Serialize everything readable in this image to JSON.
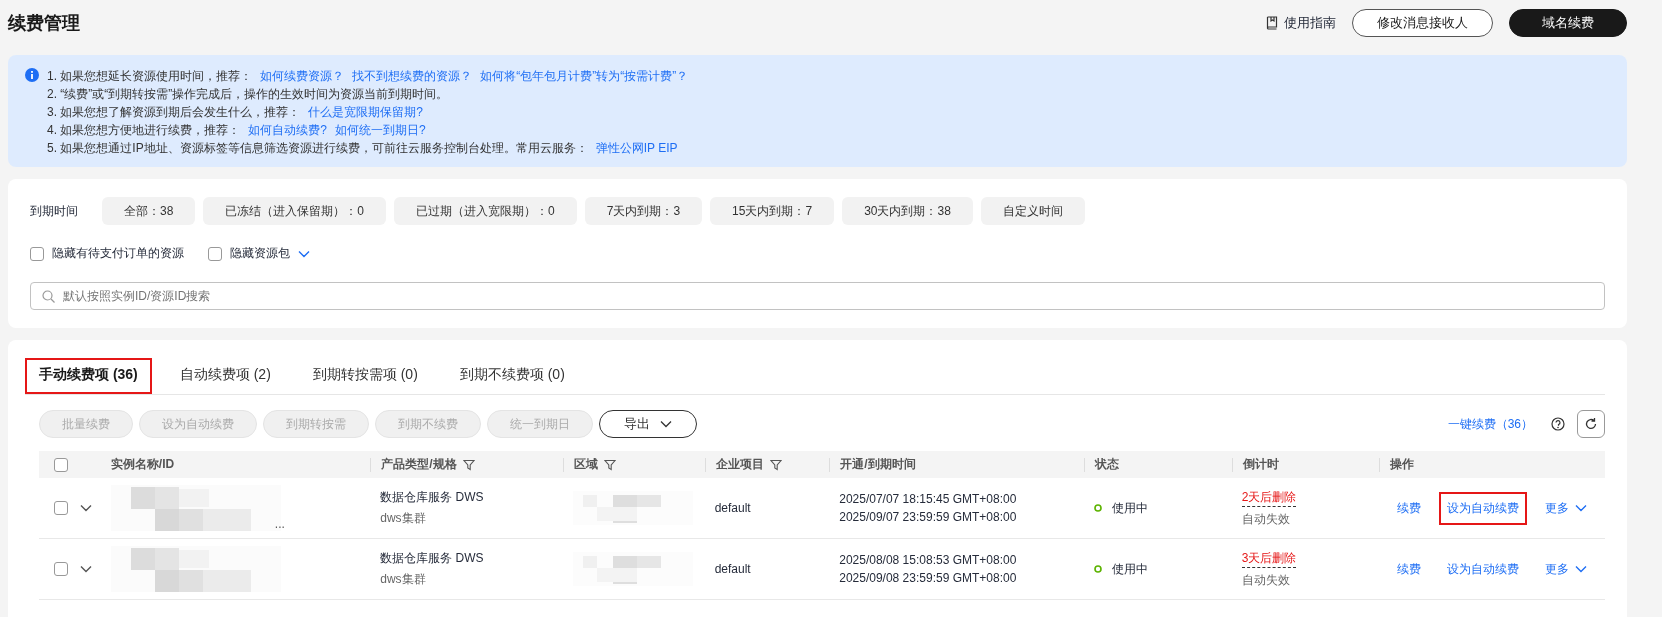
{
  "page_title": "续费管理",
  "header_actions": {
    "guide": "使用指南",
    "buttons": [
      {
        "label": "修改消息接收人",
        "kind": "outline"
      },
      {
        "label": "域名续费",
        "kind": "primary"
      }
    ]
  },
  "notice": {
    "lines": [
      {
        "text": "1. 如果您想延长资源使用时间，推荐：",
        "links": [
          "如何续费资源？",
          "找不到想续费的资源？",
          "如何将“包年包月计费”转为“按需计费”？"
        ]
      },
      {
        "text": "2. “续费”或“到期转按需”操作完成后，操作的生效时间为资源当前到期时间。"
      },
      {
        "text": "3. 如果您想了解资源到期后会发生什么，推荐：",
        "links": [
          "什么是宽限期保留期?"
        ]
      },
      {
        "text": "4. 如果您想方便地进行续费，推荐：",
        "links": [
          "如何自动续费?",
          "如何统一到期日?"
        ]
      },
      {
        "text": "5. 如果您想通过IP地址、资源标签等信息筛选资源进行续费，可前往云服务控制台处理。常用云服务：",
        "links": [
          "弹性公网IP EIP"
        ]
      }
    ]
  },
  "filters": {
    "label": "到期时间",
    "chips": [
      "全部：38",
      "已冻结（进入保留期）：0",
      "已过期（进入宽限期）：0",
      "7天内到期：3",
      "15天内到期：7",
      "30天内到期：38",
      "自定义时间"
    ],
    "checkboxes": [
      {
        "label": "隐藏有待支付订单的资源",
        "checked": false,
        "kind": "plain"
      },
      {
        "label": "隐藏资源包",
        "checked": false,
        "kind": "dropdown"
      }
    ],
    "search": {
      "placeholder": "默认按照实例ID/资源ID搜索"
    }
  },
  "tabs": [
    {
      "label": "手动续费项 (36)",
      "selected": true,
      "highlighted": true
    },
    {
      "label": "自动续费项 (2)",
      "selected": false,
      "highlighted": false
    },
    {
      "label": "到期转按需项 (0)",
      "selected": false,
      "highlighted": false
    },
    {
      "label": "到期不续费项 (0)",
      "selected": false,
      "highlighted": false
    }
  ],
  "toolbar": {
    "buttons": [
      {
        "label": "批量续费",
        "disabled": true
      },
      {
        "label": "设为自动续费",
        "disabled": true
      },
      {
        "label": "到期转按需",
        "disabled": true
      },
      {
        "label": "到期不续费",
        "disabled": true
      },
      {
        "label": "统一到期日",
        "disabled": true
      }
    ],
    "export": "导出",
    "one_click": "一键续费（36）"
  },
  "table": {
    "select_all_checked": false,
    "columns": [
      {
        "label": "实例名称/ID",
        "filter": false
      },
      {
        "label": "产品类型/规格",
        "filter": true
      },
      {
        "label": "区域",
        "filter": true
      },
      {
        "label": "企业项目",
        "filter": true
      },
      {
        "label": "开通/到期时间",
        "filter": false
      },
      {
        "label": "状态",
        "filter": false
      },
      {
        "label": "倒计时",
        "filter": false
      },
      {
        "label": "操作",
        "filter": false
      }
    ],
    "rows": [
      {
        "checked": false,
        "name_tail": "...",
        "product": "数据仓库服务 DWS",
        "spec": "dws集群",
        "project": "default",
        "opened": "2025/07/07 18:15:45 GMT+08:00",
        "expires": "2025/09/07 23:59:59 GMT+08:00",
        "status": "使用中",
        "countdown": "2天后删除",
        "countdown_note": "自动失效",
        "actions": [
          {
            "label": "续费",
            "highlighted": false
          },
          {
            "label": "设为自动续费",
            "highlighted": true
          }
        ],
        "more": "更多"
      },
      {
        "checked": false,
        "product": "数据仓库服务 DWS",
        "spec": "dws集群",
        "project": "default",
        "opened": "2025/08/08 15:08:53 GMT+08:00",
        "expires": "2025/09/08 23:59:59 GMT+08:00",
        "status": "使用中",
        "countdown": "3天后删除",
        "countdown_note": "自动失效",
        "actions": [
          {
            "label": "续费",
            "highlighted": false
          },
          {
            "label": "设为自动续费",
            "highlighted": false
          }
        ],
        "more": "更多"
      }
    ]
  }
}
